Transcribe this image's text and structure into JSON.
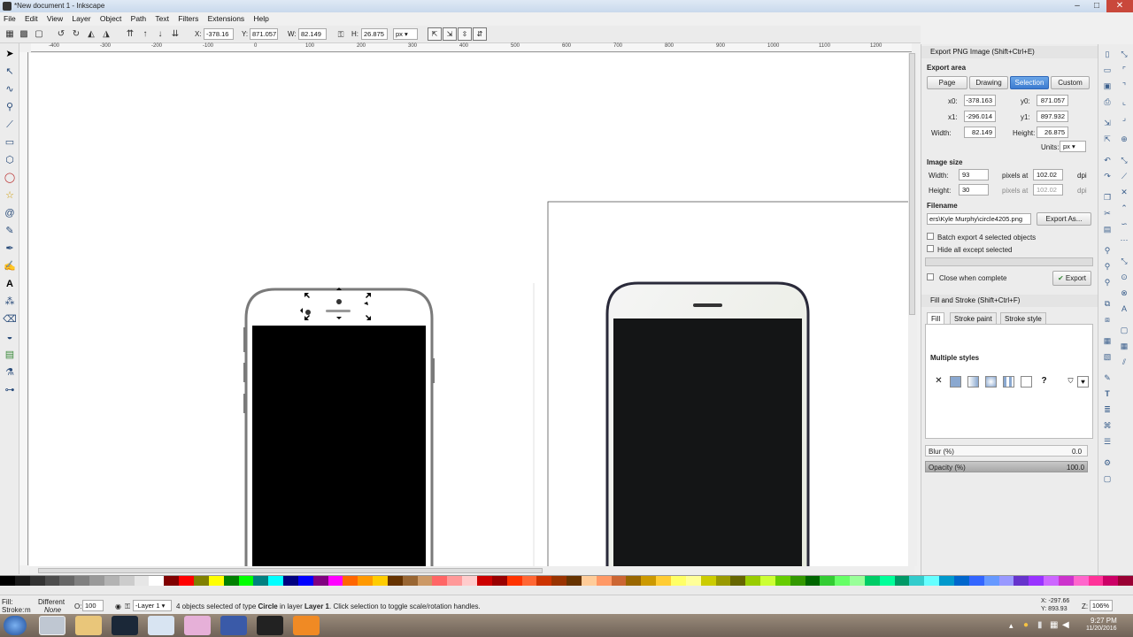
{
  "window": {
    "title": "*New document 1 - Inkscape",
    "min": "–",
    "max": "□",
    "close": "✕"
  },
  "menu": [
    "File",
    "Edit",
    "View",
    "Layer",
    "Object",
    "Path",
    "Text",
    "Filters",
    "Extensions",
    "Help"
  ],
  "toolbar": {
    "x_label": "X:",
    "x_value": "-378.16",
    "y_label": "Y:",
    "y_value": "871.057",
    "w_label": "W:",
    "w_value": "82.149",
    "h_label": "H:",
    "h_value": "26.875",
    "lock_icon": "lock-icon",
    "unit": "px"
  },
  "ruler_marks": [
    "-400",
    "-300",
    "-200",
    "-100",
    "0",
    "100",
    "200",
    "300",
    "400",
    "500",
    "600",
    "700",
    "800",
    "900",
    "1000",
    "1100",
    "1200"
  ],
  "export_panel": {
    "title": "Export PNG Image (Shift+Ctrl+E)",
    "export_area_label": "Export area",
    "area_buttons": [
      "Page",
      "Drawing",
      "Selection",
      "Custom"
    ],
    "active_area": "Selection",
    "x0_label": "x0:",
    "x0": "-378.163",
    "y0_label": "y0:",
    "y0": "871.057",
    "x1_label": "x1:",
    "x1": "-296.014",
    "y1_label": "y1:",
    "y1": "897.932",
    "width_label": "Width:",
    "width": "82.149",
    "height_label": "Height:",
    "height": "26.875",
    "units_label": "Units:",
    "units": "px",
    "image_size_label": "Image size",
    "img_width_label": "Width:",
    "img_width": "93",
    "img_height_label": "Height:",
    "img_height": "30",
    "pixels_at": "pixels at",
    "dpi_x": "102.02",
    "dpi_y": "102.02",
    "dpi_label": "dpi",
    "filename_label": "Filename",
    "filename": "ers\\Kyle Murphy\\circle4205.png",
    "export_as": "Export As...",
    "batch_label": "Batch export 4 selected objects",
    "hide_label": "Hide all except selected",
    "close_when_complete": "Close when complete",
    "export_button": "Export"
  },
  "fill_panel": {
    "title": "Fill and Stroke (Shift+Ctrl+F)",
    "tabs": [
      "Fill",
      "Stroke paint",
      "Stroke style"
    ],
    "multiple_styles": "Multiple styles",
    "blur_label": "Blur (%)",
    "blur_value": "0.0",
    "opacity_label": "Opacity (%)",
    "opacity_value": "100.0"
  },
  "status": {
    "fill_label": "Fill:",
    "fill_value": "Different",
    "stroke_label": "Stroke:",
    "stroke_value": "m",
    "stroke_none": "None",
    "opacity_label": "O:",
    "opacity_value": "100",
    "layer": "-Layer 1",
    "message_pre": "4 objects selected of type ",
    "message_type": "Circle",
    "message_mid": " in layer ",
    "message_layer": "Layer 1",
    "message_post": ". Click selection to toggle scale/rotation handles.",
    "coord_x": "X: -297.66",
    "coord_y": "Y: 893.93",
    "zoom_label": "Z:",
    "zoom_value": "106%"
  },
  "clock": {
    "time": "9:27 PM",
    "date": "11/20/2016"
  },
  "colors": {
    "accent": "#3c7bd0",
    "phone_stroke": "#7a7a7a",
    "phone_dark": "#2a2a3a",
    "screen": "#000000"
  },
  "palette": [
    "#000000",
    "#1a1a1a",
    "#333333",
    "#4d4d4d",
    "#666666",
    "#808080",
    "#999999",
    "#b3b3b3",
    "#cccccc",
    "#e6e6e6",
    "#ffffff",
    "#800000",
    "#ff0000",
    "#808000",
    "#ffff00",
    "#008000",
    "#00ff00",
    "#008080",
    "#00ffff",
    "#000080",
    "#0000ff",
    "#800080",
    "#ff00ff",
    "#ff6600",
    "#ff9900",
    "#ffcc00",
    "#663300",
    "#996633",
    "#cc9966",
    "#ff6666",
    "#ff9999",
    "#ffcccc",
    "#cc0000",
    "#990000",
    "#ff3300",
    "#ff6633",
    "#cc3300",
    "#993300",
    "#663300",
    "#ffcc99",
    "#ff9966",
    "#cc6633",
    "#996600",
    "#cc9900",
    "#ffcc33",
    "#ffff66",
    "#ffff99",
    "#cccc00",
    "#999900",
    "#666600",
    "#99cc00",
    "#ccff33",
    "#66cc00",
    "#339900",
    "#006600",
    "#33cc33",
    "#66ff66",
    "#99ff99",
    "#00cc66",
    "#00ff99",
    "#009966",
    "#33cccc",
    "#66ffff",
    "#0099cc",
    "#0066cc",
    "#3366ff",
    "#6699ff",
    "#9999ff",
    "#6633cc",
    "#9933ff",
    "#cc66ff",
    "#cc33cc",
    "#ff66cc",
    "#ff3399",
    "#cc0066",
    "#990033"
  ]
}
